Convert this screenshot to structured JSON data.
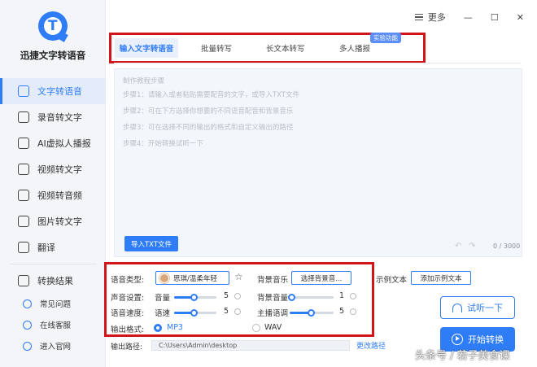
{
  "app": {
    "name": "迅捷文字转语音"
  },
  "window": {
    "more_label": "更多",
    "minimize": "—",
    "maximize": "☐",
    "close": "✕"
  },
  "sidebar": {
    "items": [
      {
        "label": "文字转语音",
        "icon": "text-to-speech-icon",
        "active": true
      },
      {
        "label": "录音转文字",
        "icon": "record-icon"
      },
      {
        "label": "AI虚拟人播报",
        "icon": "ai-avatar-icon"
      },
      {
        "label": "视频转文字",
        "icon": "video-text-icon"
      },
      {
        "label": "视频转音频",
        "icon": "video-audio-icon"
      },
      {
        "label": "图片转文字",
        "icon": "image-text-icon"
      },
      {
        "label": "翻译",
        "icon": "translate-icon"
      },
      {
        "label": "转换结果",
        "icon": "result-icon"
      }
    ],
    "bottom_links": [
      {
        "label": "常见问题",
        "icon": "question-icon"
      },
      {
        "label": "在线客服",
        "icon": "support-icon"
      },
      {
        "label": "进入官网",
        "icon": "website-icon"
      }
    ]
  },
  "tabs": {
    "items": [
      "输入文字转语音",
      "批量转写",
      "长文本转写",
      "多人播报"
    ],
    "badge": "实验功能"
  },
  "editor": {
    "hints": [
      "制作教程步骤",
      "步骤1：请输入或者粘贴需要配音的文字，或导入TXT文件",
      "步骤2：可在下方选择你想要的不同语音配音和背景音乐",
      "步骤3：可在选择不同的输出的格式和自定义输出的路径",
      "步骤4：开始转换试听一下"
    ],
    "import_label": "导入TXT文件",
    "undo": "↶",
    "redo": "↷",
    "counter": "0 / 3000"
  },
  "settings": {
    "voice_type_label": "语音类型:",
    "voice_name": "思琪/温柔年轻",
    "bg_music_label": "背景音乐",
    "bg_music_button": "选择背景音...",
    "example_text_label": "示例文本",
    "example_text_button": "添加示例文本",
    "sound_settings_label": "声音设置:",
    "volume_label": "音量",
    "volume_value": "5",
    "bg_volume_label": "背景音量",
    "bg_volume_value": "1",
    "speed_label": "语音速度:",
    "speed_sub_label": "语速",
    "speed_value": "5",
    "pitch_label": "主播语调",
    "pitch_value": "5",
    "format_label": "输出格式:",
    "format_options": [
      "MP3",
      "WAV"
    ],
    "format_selected": "MP3"
  },
  "output": {
    "path_label": "输出路径:",
    "path_value": "C:\\Users\\Admin\\desktop",
    "change_path": "更改路径"
  },
  "actions": {
    "listen": "试听一下",
    "convert": "开始转换"
  },
  "watermark": "头条号 / 若子美食课",
  "colors": {
    "accent": "#2f7df6",
    "highlight_box": "#d0161b"
  }
}
